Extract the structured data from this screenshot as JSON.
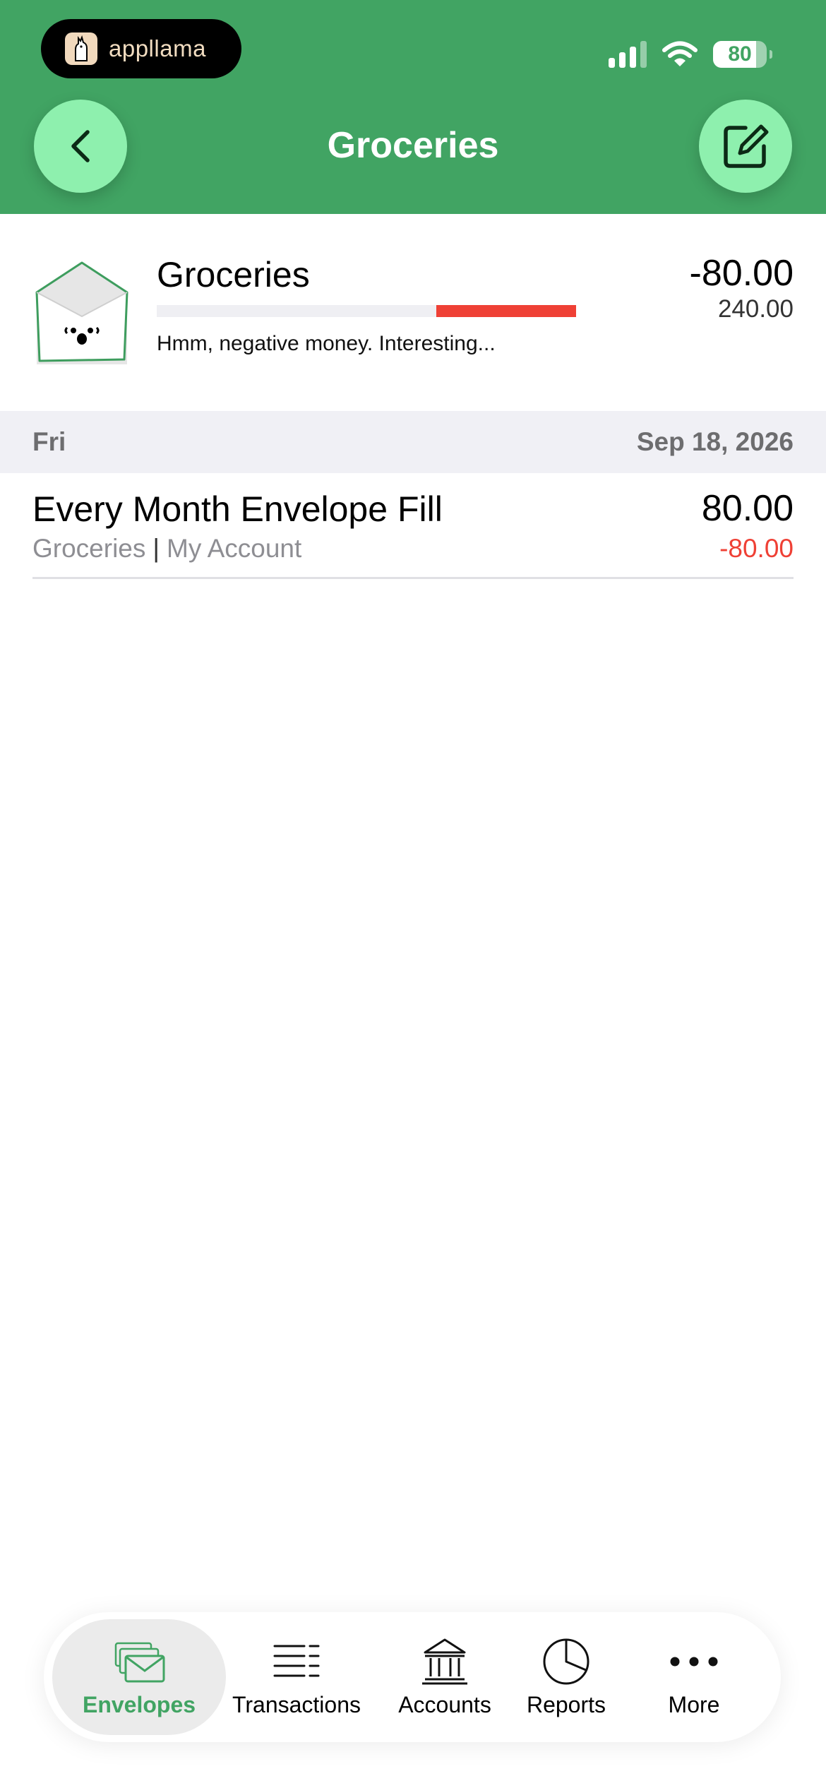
{
  "app_badge": {
    "name": "appllama"
  },
  "status_bar": {
    "battery": "80"
  },
  "header": {
    "title": "Groceries"
  },
  "envelope": {
    "name": "Groceries",
    "balance": "-80.00",
    "budget": "240.00",
    "note": "Hmm, negative money. Interesting...",
    "overspent_fraction": 0.333
  },
  "day_group": {
    "weekday": "Fri",
    "date": "Sep 18, 2026"
  },
  "transactions": [
    {
      "title": "Every Month Envelope Fill",
      "amount": "80.00",
      "envelope": "Groceries",
      "separator": "|",
      "account": "My Account",
      "envelope_amount": "-80.00"
    }
  ],
  "tabs": [
    {
      "label": "Envelopes",
      "icon": "envelopes-icon",
      "active": true
    },
    {
      "label": "Transactions",
      "icon": "list-icon",
      "active": false
    },
    {
      "label": "Accounts",
      "icon": "bank-icon",
      "active": false
    },
    {
      "label": "Reports",
      "icon": "pie-chart-icon",
      "active": false
    },
    {
      "label": "More",
      "icon": "more-icon",
      "active": false
    }
  ],
  "colors": {
    "brand_green": "#41a463",
    "button_green": "#8ef0ae",
    "negative_red": "#ef4035"
  }
}
